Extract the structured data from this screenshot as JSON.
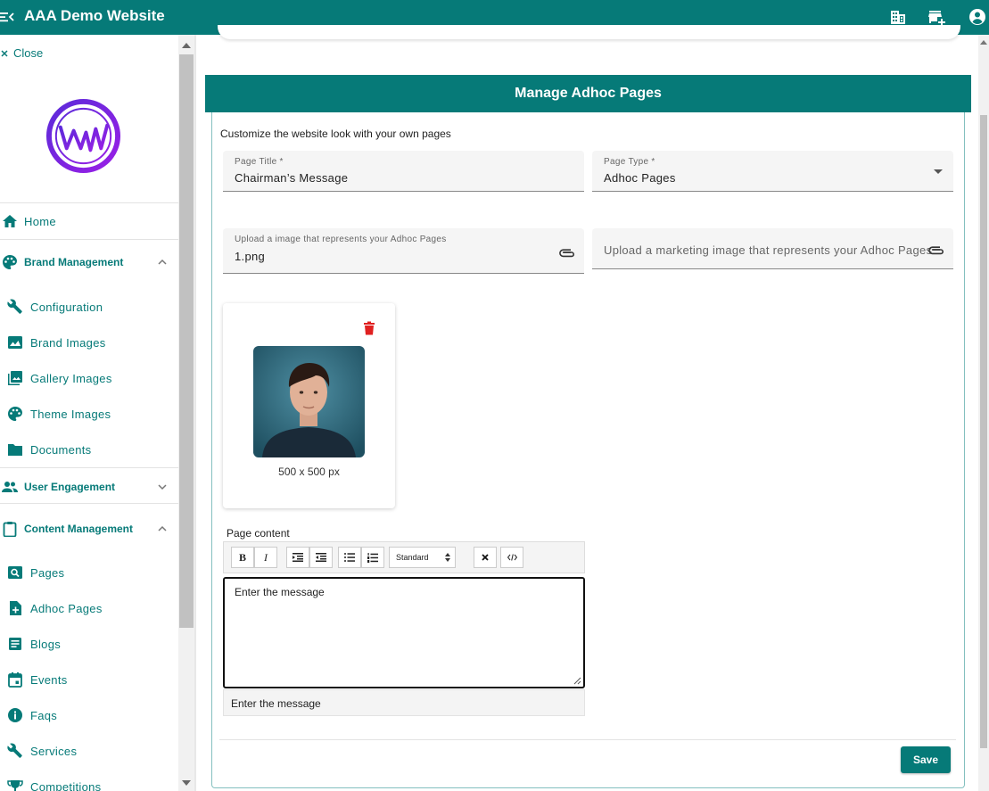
{
  "app": {
    "title": "AAA Demo Website"
  },
  "topbar": {
    "icons": [
      "building-icon",
      "store-add-icon",
      "account-circle-icon"
    ]
  },
  "sidebar": {
    "close_label": "Close",
    "items": [
      {
        "label": "Home",
        "icon": "home-icon"
      },
      {
        "label": "Brand Management",
        "icon": "palette-icon",
        "expanded": true
      },
      {
        "label": "Configuration",
        "icon": "wrench-icon"
      },
      {
        "label": "Brand Images",
        "icon": "image-icon"
      },
      {
        "label": "Gallery Images",
        "icon": "photo-library-icon"
      },
      {
        "label": "Theme Images",
        "icon": "palette-icon"
      },
      {
        "label": "Documents",
        "icon": "folder-icon"
      },
      {
        "label": "User Engagement",
        "icon": "people-icon",
        "expanded": false
      },
      {
        "label": "Content Management",
        "icon": "clipboard-icon",
        "expanded": true
      },
      {
        "label": "Pages",
        "icon": "pageview-icon"
      },
      {
        "label": "Adhoc Pages",
        "icon": "note-add-icon"
      },
      {
        "label": "Blogs",
        "icon": "article-icon"
      },
      {
        "label": "Events",
        "icon": "calendar-icon"
      },
      {
        "label": "Faqs",
        "icon": "info-icon"
      },
      {
        "label": "Services",
        "icon": "wrench-icon"
      },
      {
        "label": "Competitions",
        "icon": "trophy-icon"
      }
    ]
  },
  "main": {
    "heading": "Manage Adhoc Pages",
    "intro": "Customize the website look with your own pages",
    "page_title": {
      "label": "Page Title *",
      "value": "Chairman’s Message"
    },
    "page_type": {
      "label": "Page Type *",
      "value": "Adhoc Pages"
    },
    "upload_image": {
      "label": "Upload a image that represents your Adhoc Pages",
      "value": "1.png"
    },
    "upload_marketing": {
      "placeholder": "Upload a marketing image that represents your Adhoc Pages"
    },
    "image_card": {
      "dimensions": "500 x 500 px"
    },
    "content": {
      "label": "Page content",
      "toolbar": {
        "bold": "B",
        "italic": "I",
        "format_select": "Standard"
      },
      "editor_text": "Enter the  message",
      "preview_text": "Enter the  message"
    },
    "save_label": "Save"
  },
  "colors": {
    "brand": "#067a78",
    "danger": "#e02020",
    "logo": "#7a22e0"
  }
}
